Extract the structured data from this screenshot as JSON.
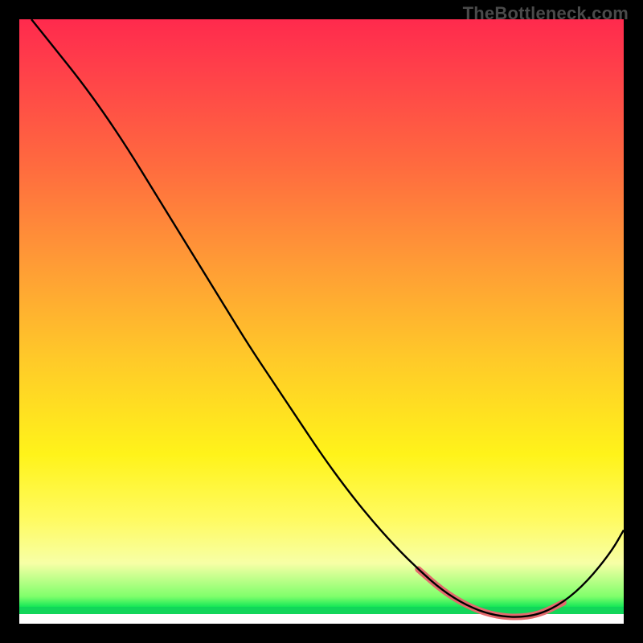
{
  "watermark": "TheBottleneck.com",
  "chart_data": {
    "type": "line",
    "title": "",
    "xlabel": "",
    "ylabel": "",
    "xlim": [
      0,
      100
    ],
    "ylim": [
      0,
      100
    ],
    "grid": false,
    "legend": false,
    "series": [
      {
        "name": "bottleneck-curve",
        "x": [
          2,
          6,
          10,
          14,
          18,
          22,
          26,
          30,
          34,
          38,
          42,
          46,
          50,
          54,
          58,
          62,
          66,
          70,
          74,
          78,
          82,
          86,
          90,
          94,
          98,
          100
        ],
        "y": [
          100,
          95,
          90,
          84.5,
          78.5,
          72,
          65.5,
          59,
          52.5,
          46,
          40,
          34,
          28,
          22.5,
          17.5,
          13,
          9,
          5.5,
          3,
          1.5,
          1,
          1.5,
          3.5,
          7,
          12,
          15.5
        ]
      }
    ],
    "highlight_range_x": [
      66,
      92
    ],
    "gradient_stops": [
      {
        "pos": 0,
        "color": "#ff2a4d"
      },
      {
        "pos": 24,
        "color": "#ff6a3f"
      },
      {
        "pos": 56,
        "color": "#ffc929"
      },
      {
        "pos": 83,
        "color": "#fffb63"
      },
      {
        "pos": 96,
        "color": "#17e858"
      },
      {
        "pos": 100,
        "color": "#ffffff"
      }
    ]
  }
}
